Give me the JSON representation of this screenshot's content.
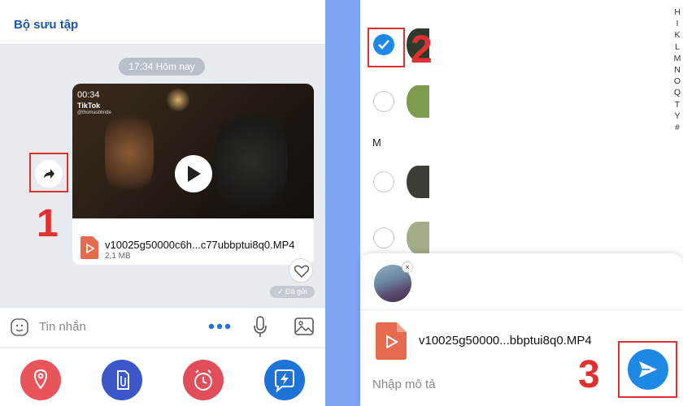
{
  "left_panel": {
    "collection_title": "Bộ sưu tập",
    "time_divider": "17:34 Hôm nay",
    "video": {
      "duration": "00:34",
      "brand": "TikTok",
      "handle": "@thomasblinde",
      "file_name": "v10025g50000c6h...c77ubbptui8q0.MP4",
      "file_size": "2,1 MB"
    },
    "sent_status": "✓ Đã gửi",
    "input_placeholder": "Tin nhắn",
    "action_colors": [
      "#e8555a",
      "#3a56c9",
      "#e14e5a",
      "#1d73d8"
    ]
  },
  "right_panel": {
    "section_letter": "M",
    "alpha_index": [
      "H",
      "I",
      "K",
      "L",
      "M",
      "N",
      "O",
      "Q",
      "T",
      "Y",
      "#"
    ],
    "sheet": {
      "file_name": "v10025g50000...bbptui8q0.MP4",
      "description_placeholder": "Nhập mô tả",
      "thumb_close": "×"
    }
  },
  "annotations": {
    "step1": "1",
    "step2": "2",
    "step3": "3",
    "color": "#e03030"
  },
  "colors": {
    "accent_blue": "#1e88e5",
    "divider_blue": "#7fa4f4",
    "file_orange": "#e66a4e"
  }
}
